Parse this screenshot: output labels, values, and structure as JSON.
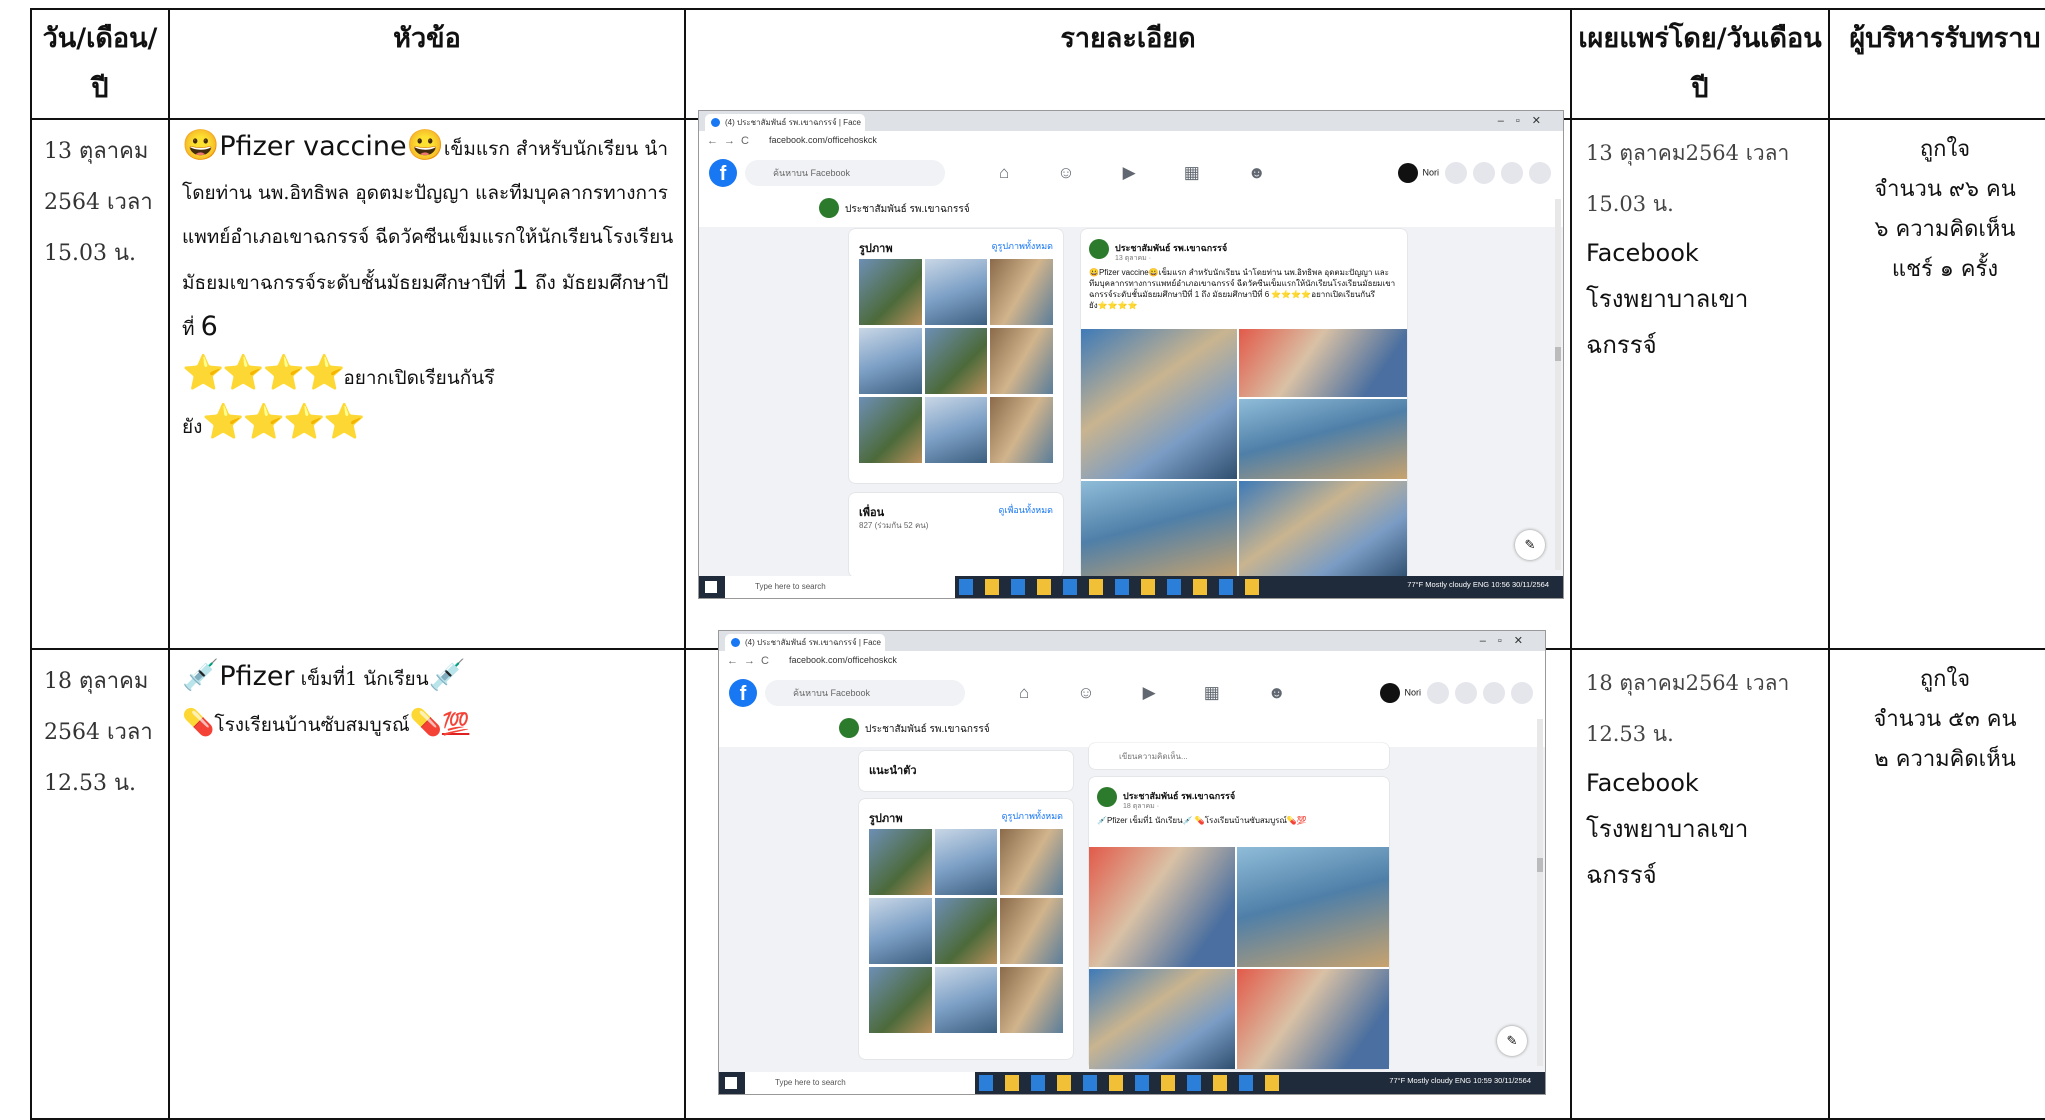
{
  "headers": {
    "date": "วัน/เดือน/ปี",
    "topic": "หัวข้อ",
    "detail": "รายละเอียด",
    "published": "เผยแพร่โดย/วันเดือนปี",
    "admin": "ผู้บริหารรับทราบ"
  },
  "rows": [
    {
      "date_line1": "13 ตุลาคม",
      "date_line2": "2564 เวลา",
      "date_line3": "15.03 น.",
      "topic_emoji": "😀",
      "topic_title": "Pfizer vaccine",
      "topic_text": "เข็มแรก สำหรับนักเรียน นำโดยท่าน นพ.อิทธิพล อุดตมะปัญญา และทีมบุคลากรทางการแพทย์อำเภอเขาฉกรรจ์ ฉีดวัคซีนเข็มแรกให้นักเรียนโรงเรียนมัธยมเขาฉกรรจ์ระดับชั้นมัธยมศึกษาปีที่",
      "topic_grade_from": "1",
      "topic_to": "ถึง มัธยมศึกษาปีที่",
      "topic_grade_to": "6",
      "topic_stars": "⭐⭐⭐⭐",
      "topic_tagline": "อยากเปิดเรียนกันรึยัง",
      "pub_date": "13 ตุลาคม2564 เวลา",
      "pub_time": "15.03 น.",
      "pub_platform": "Facebook",
      "pub_org": "โรงพยาบาลเขาฉกรรจ์",
      "admin_like": "ถูกใจ",
      "admin_count": "จำนวน ๙๖ คน",
      "admin_comments": "๖ ความคิดเห็น",
      "admin_shares": "แชร์ ๑ ครั้ง",
      "shot": {
        "tab": "(4) ประชาสัมพันธ์ รพ.เขาฉกรรจ์ | Face",
        "url": "facebook.com/officehoskck",
        "search": "ค้นหาบน Facebook",
        "user": "Nori",
        "page_name": "ประชาสัมพันธ์ รพ.เขาฉกรรจ์",
        "photos_title": "รูปภาพ",
        "photos_link": "ดูรูปภาพทั้งหมด",
        "friends_title": "เพื่อน",
        "friends_link": "ดูเพื่อนทั้งหมด",
        "friends_count": "827 (ร่วมกัน 52 คน)",
        "post_name": "ประชาสัมพันธ์ รพ.เขาฉกรรจ์",
        "post_date": "13 ตุลาคม · ",
        "post_text": "😀Pfizer vaccine😀เข็มแรก สำหรับนักเรียน นำโดยท่าน นพ.อิทธิพล อุดตมะปัญญา และทีมบุคลากรทางการแพทย์อำเภอเขาฉกรรจ์ ฉีดวัคซีนเข็มแรกให้นักเรียนโรงเรียนมัธยมเขาฉกรรจ์ระดับชั้นมัธยมศึกษาปีที่ 1 ถึง มัธยมศึกษาปีที่ 6 ⭐⭐⭐⭐อยากเปิดเรียนกันรึยัง⭐⭐⭐⭐",
        "taskbar_search": "Type here to search",
        "tray": "77°F  Mostly cloudy  ENG  10:56  30/11/2564"
      }
    },
    {
      "date_line1": "18 ตุลาคม",
      "date_line2": "2564 เวลา",
      "date_line3": "12.53 น.",
      "topic_emoji": "💉",
      "topic_title": "Pfizer",
      "topic_text": "เข็มที่1 นักเรียน",
      "topic_line2": "โรงเรียนบ้านซับสมบูรณ์",
      "topic_pill": "💊",
      "topic_hundred": "💯",
      "pub_date": "18 ตุลาคม2564 เวลา",
      "pub_time": "12.53 น.",
      "pub_platform": "Facebook",
      "pub_org": "โรงพยาบาลเขาฉกรรจ์",
      "admin_like": "ถูกใจ",
      "admin_count": "จำนวน ๕๓ คน",
      "admin_comments": "๒ ความคิดเห็น",
      "shot": {
        "tab": "(4) ประชาสัมพันธ์ รพ.เขาฉกรรจ์ | Face",
        "url": "facebook.com/officehoskck",
        "search": "ค้นหาบน Facebook",
        "user": "Nori",
        "page_name": "ประชาสัมพันธ์ รพ.เขาฉกรรจ์",
        "intro_title": "แนะนำตัว",
        "photos_title": "รูปภาพ",
        "photos_link": "ดูรูปภาพทั้งหมด",
        "compose": "เขียนความคิดเห็น...",
        "post_name": "ประชาสัมพันธ์ รพ.เขาฉกรรจ์",
        "post_date": "18 ตุลาคม · ",
        "post_text": "💉Pfizer เข็มที่1 นักเรียน💉 💊โรงเรียนบ้านซับสมบูรณ์💊💯",
        "taskbar_search": "Type here to search",
        "tray": "77°F  Mostly cloudy  ENG  10:59  30/11/2564"
      }
    }
  ]
}
